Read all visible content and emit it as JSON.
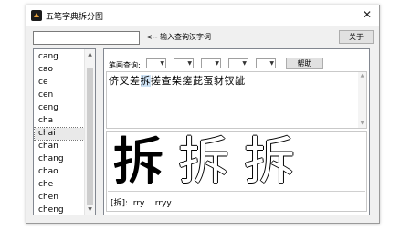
{
  "window": {
    "title": "五笔字典拆分图",
    "close_glyph": "✕",
    "icon": "app-icon"
  },
  "search": {
    "value": "",
    "hint": "<-- 输入查询汉字词",
    "about_label": "关于"
  },
  "pinyin_list": {
    "items": [
      "cang",
      "cao",
      "ce",
      "cen",
      "ceng",
      "cha",
      "chai",
      "chan",
      "chang",
      "chao",
      "che",
      "chen",
      "cheng"
    ],
    "selected": "chai"
  },
  "lookup": {
    "label": "笔画查询:",
    "combos": [
      "",
      "",
      "",
      "",
      ""
    ],
    "help_label": "帮助"
  },
  "chars": {
    "before": "侪叉差",
    "highlight": "拆",
    "after": "搓查柴瘥茈虿豺钗龇"
  },
  "glyph": {
    "char": "拆",
    "code_text": "[拆]:  rry    rryy"
  },
  "colors": {
    "highlight": "#cfe4f7",
    "window_bg": "#f0f0f0",
    "icon": "#e8a33d"
  }
}
